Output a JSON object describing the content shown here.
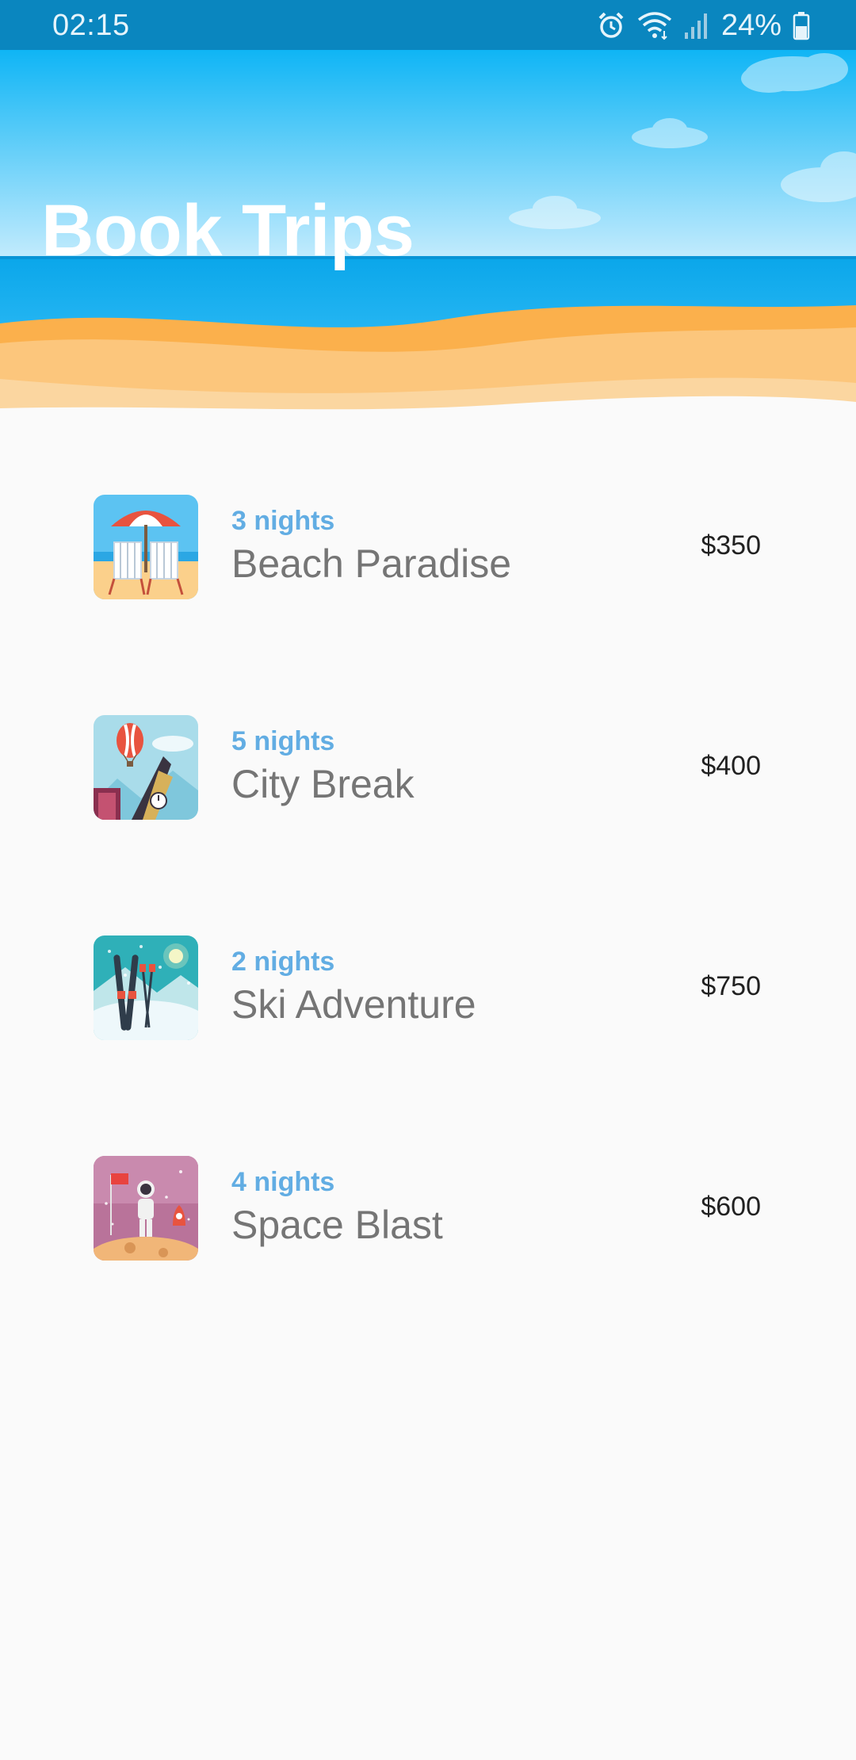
{
  "status_bar": {
    "time": "02:15",
    "battery": "24%",
    "icons": [
      "alarm-icon",
      "wifi-icon",
      "signal-icon",
      "battery-icon"
    ]
  },
  "header": {
    "title": "Book Trips"
  },
  "trips": [
    {
      "nights": "3 nights",
      "name": "Beach Paradise",
      "price": "$350",
      "icon": "beach-chairs-icon"
    },
    {
      "nights": "5 nights",
      "name": "City Break",
      "price": "$400",
      "icon": "big-ben-balloon-icon"
    },
    {
      "nights": "2 nights",
      "name": "Ski Adventure",
      "price": "$750",
      "icon": "skis-icon"
    },
    {
      "nights": "4 nights",
      "name": "Space Blast",
      "price": "$600",
      "icon": "astronaut-icon"
    }
  ],
  "colors": {
    "status_bar": "#0a86bf",
    "sky": "#11b8f7",
    "sea": "#0aa3e6",
    "sand": "#fbb65a",
    "nights_accent": "#62ade3",
    "trip_name": "#757575",
    "price": "#212121",
    "background": "#fafafa"
  }
}
